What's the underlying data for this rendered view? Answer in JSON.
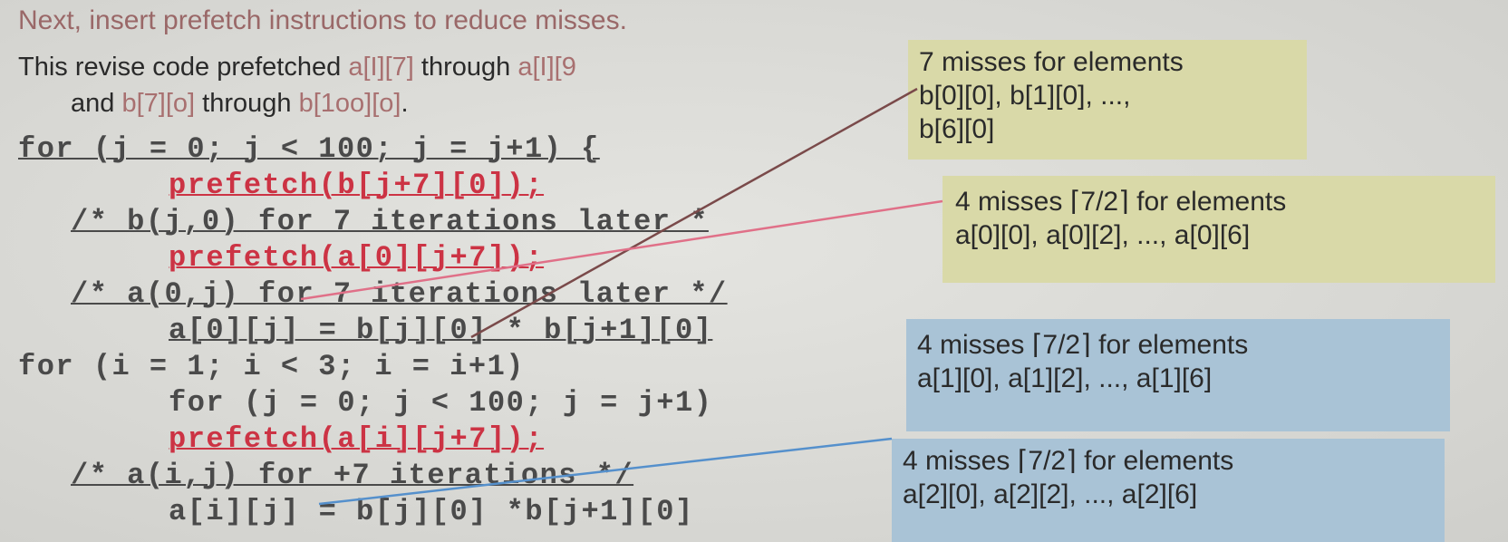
{
  "heading": "Next, insert prefetch instructions to reduce misses.",
  "intro": {
    "line1_a": "This revise code prefetched ",
    "line1_b": "a[I][7]",
    "line1_c": " through ",
    "line1_d": "a[I][9",
    "line2_a": "and ",
    "line2_b": "b[7][o]",
    "line2_c": " through ",
    "line2_d": "b[1oo][o]",
    "line2_e": "."
  },
  "code": [
    "for (j = 0; j < 100; j = j+1) {",
    "prefetch(b[j+7][0]);",
    "/* b(j,0) for 7 iterations later *",
    "prefetch(a[0][j+7]);",
    "/* a(0,j) for 7 iterations later */",
    "a[0][j] = b[j][0] * b[j+1][0]",
    "for (i = 1; i < 3; i = i+1)",
    "for (j = 0; j < 100; j = j+1)",
    "prefetch(a[i][j+7]);",
    "/* a(i,j) for +7 iterations */",
    "a[i][j] = b[j][0] *b[j+1][0]"
  ],
  "boxes": [
    {
      "line1": "7 misses for elements",
      "line2": "b[0][0], b[1][0], ...,",
      "line3": "b[6][0]"
    },
    {
      "line1": "4 misses ⌈7/2⌉ for elements",
      "line2": "a[0][0], a[0][2], ..., a[0][6]"
    },
    {
      "line1": "4 misses ⌈7/2⌉ for elements",
      "line2": "a[1][0], a[1][2], ..., a[1][6]"
    },
    {
      "line1": "4 misses ⌈7/2⌉ for elements",
      "line2": "a[2][0], a[2][2], ..., a[2][6]"
    }
  ],
  "colors": {
    "heading": "#9a6868",
    "highlight": "#cc3344",
    "yellow_box": "#d9d9a8",
    "blue_box": "#a9c3d6",
    "line_brown": "#7a4a4a",
    "line_pink": "#e07088",
    "line_blue": "#5590cc"
  }
}
